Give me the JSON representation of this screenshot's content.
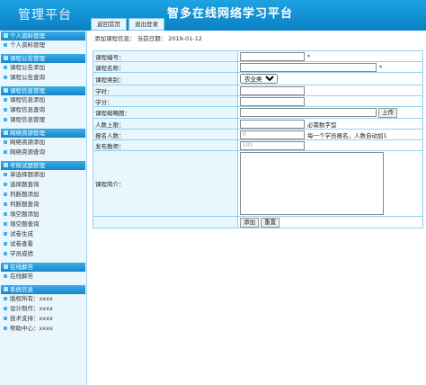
{
  "header": {
    "logo": "管理平台",
    "title": "智多在线网络学习平台",
    "tabs": [
      "返回首页",
      "退出登录"
    ]
  },
  "sidebar": {
    "sections": [
      {
        "title": "个人资料管理",
        "items": [
          "个人资料管理"
        ]
      },
      {
        "title": "课程公告管理",
        "items": [
          "课程公告添加",
          "课程公告查询"
        ]
      },
      {
        "title": "课程信息管理",
        "items": [
          "课程信息添加",
          "课程信息查询",
          "课程信息管理"
        ]
      },
      {
        "title": "网络资源管理",
        "items": [
          "网络资源添加",
          "网络资源查询"
        ]
      },
      {
        "title": "考核试题管理",
        "items": [
          "单选择题添加",
          "选择题查询",
          "判断题添加",
          "判断题查询",
          "填空题添加",
          "填空题查询",
          "试卷生成",
          "试卷查看",
          "学员成绩"
        ]
      },
      {
        "title": "在线解答",
        "items": [
          "在线解答"
        ]
      },
      {
        "title": "系统信息",
        "items": [
          "版权所有：xxxx",
          "设计制作：xxxx",
          "技术支持：xxxx",
          "帮助中心：xxxx"
        ]
      }
    ]
  },
  "main": {
    "info": "添加课程信息：  当前日期：  2019-01-12",
    "fields": {
      "code_label": "课程编号：",
      "name_label": "课程名称：",
      "category_label": "课程类别：",
      "category_value": "农业类",
      "hours_label": "学时：",
      "credit_label": "学分：",
      "thumb_label": "课程缩略图：",
      "upload_btn": "上传",
      "limit_label": "人数上限：",
      "limit_hint": "必需数字型",
      "enrolled_label": "报名人数：",
      "enrolled_value": "0",
      "enrolled_hint": "每一个学员报名，人数自动加1",
      "teacher_label": "发布教师：",
      "teacher_value": "101",
      "intro_label": "课程简介：",
      "required_mark": "*"
    },
    "buttons": {
      "add": "添加",
      "reset": "重置"
    }
  }
}
